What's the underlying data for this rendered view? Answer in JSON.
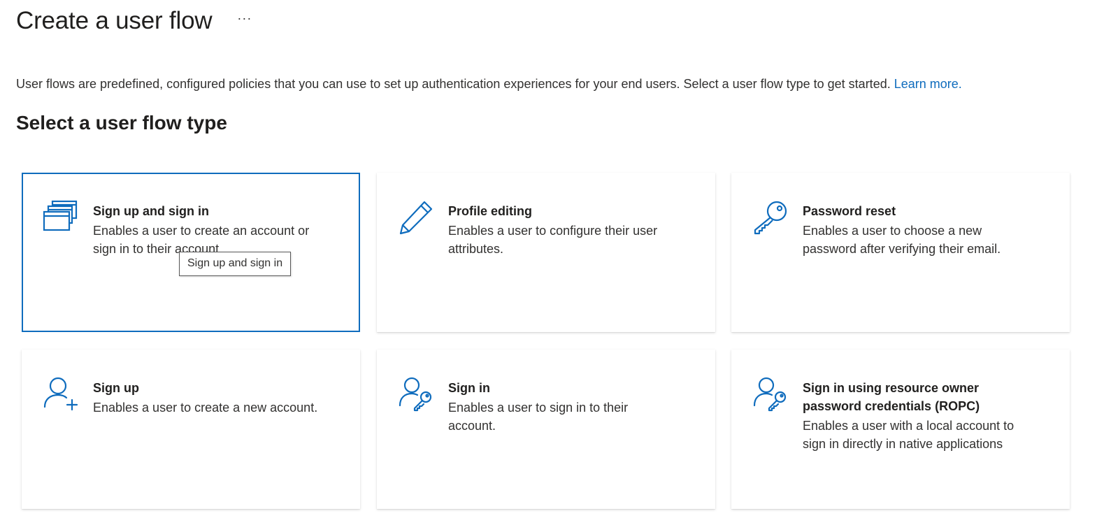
{
  "page": {
    "title": "Create a user flow",
    "more_label": "···"
  },
  "intro": {
    "text": "User flows are predefined, configured policies that you can use to set up authentication experiences for your end users. Select a user flow type to get started. ",
    "link_text": "Learn more."
  },
  "section_title": "Select a user flow type",
  "colors": {
    "accent": "#0f6cbd",
    "icon": "#0f6cbd"
  },
  "cards": [
    {
      "icon": "stacked-windows-icon",
      "title": "Sign up and sign in",
      "description": "Enables a user to create an account or sign in to their account.",
      "selected": true
    },
    {
      "icon": "pencil-icon",
      "title": "Profile editing",
      "description": "Enables a user to configure their user attributes."
    },
    {
      "icon": "key-icon",
      "title": "Password reset",
      "description": "Enables a user to choose a new password after verifying their email."
    },
    {
      "icon": "person-add-icon",
      "title": "Sign up",
      "description": "Enables a user to create a new account."
    },
    {
      "icon": "person-key-icon",
      "title": "Sign in",
      "description": "Enables a user to sign in to their account."
    },
    {
      "icon": "person-key-icon",
      "title": "Sign in using resource owner password credentials (ROPC)",
      "description": "Enables a user with a local account to sign in directly in native applications"
    }
  ],
  "tooltip": {
    "text": "Sign up and sign in"
  }
}
